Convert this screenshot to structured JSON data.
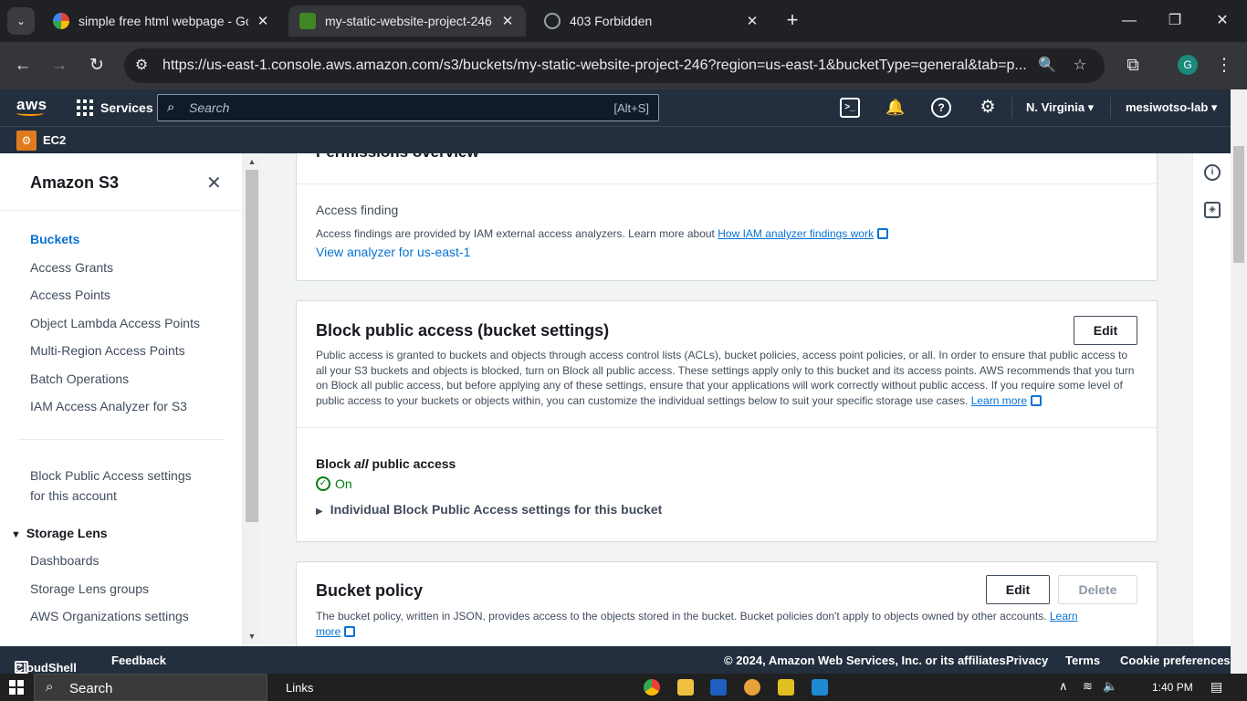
{
  "browser": {
    "tabs": [
      {
        "title": "simple free html webpage - Go",
        "favicon": "google-icon"
      },
      {
        "title": "my-static-website-project-246 -",
        "favicon": "s3-bucket-icon"
      },
      {
        "title": "403 Forbidden",
        "favicon": "globe-icon"
      }
    ],
    "url": "https://us-east-1.console.aws.amazon.com/s3/buckets/my-static-website-project-246?region=us-east-1&bucketType=general&tab=p...",
    "profile_initial": "G"
  },
  "aws_nav": {
    "logo": "aws",
    "services_label": "Services",
    "search_placeholder": "Search",
    "search_hint": "[Alt+S]",
    "region": "N. Virginia",
    "account": "mesiwotso-lab",
    "favorite": "EC2"
  },
  "sidebar": {
    "title": "Amazon S3",
    "items": [
      "Buckets",
      "Access Grants",
      "Access Points",
      "Object Lambda Access Points",
      "Multi-Region Access Points",
      "Batch Operations",
      "IAM Access Analyzer for S3"
    ],
    "block_public_line1": "Block Public Access settings",
    "block_public_line2": "for this account",
    "storage_lens": "Storage Lens",
    "storage_items": [
      "Dashboards",
      "Storage Lens groups",
      "AWS Organizations settings"
    ]
  },
  "main": {
    "permissions_heading": "Permissions overview",
    "access_finding_label": "Access finding",
    "access_finding_text": "Access findings are provided by IAM external access analyzers. Learn more about",
    "access_finding_link": "How IAM analyzer findings work",
    "view_analyzer": "View analyzer for us-east-1",
    "block_heading": "Block public access (bucket settings)",
    "block_edit": "Edit",
    "block_description": "Public access is granted to buckets and objects through access control lists (ACLs), bucket policies, access point policies, or all. In order to ensure that public access to all your S3 buckets and objects is blocked, turn on Block all public access. These settings apply only to this bucket and its access points. AWS recommends that you turn on Block all public access, but before applying any of these settings, ensure that your applications will work correctly without public access. If you require some level of public access to your buckets or objects within, you can customize the individual settings below to suit your specific storage use cases.",
    "learn_more": "Learn more",
    "block_all_pre": "Block ",
    "block_all_em": "all",
    "block_all_post": " public access",
    "status": "On",
    "individual_settings": "Individual Block Public Access settings for this bucket",
    "policy_heading": "Bucket policy",
    "policy_edit": "Edit",
    "policy_delete": "Delete",
    "policy_text": "The bucket policy, written in JSON, provides access to the objects stored in the bucket. Bucket policies don't apply to objects owned by other accounts.",
    "policy_learn": "Learn",
    "policy_more": "more"
  },
  "footer": {
    "cloudshell": "CloudShell",
    "feedback": "Feedback",
    "copyright": "© 2024, Amazon Web Services, Inc. or its affiliates.",
    "privacy": "Privacy",
    "terms": "Terms",
    "cookie": "Cookie preferences"
  },
  "taskbar": {
    "search": "Search",
    "links": "Links",
    "time": "1:40 PM"
  },
  "colors": {
    "aws_header": "#232f3e",
    "aws_orange": "#ff9900",
    "link_blue": "#0972d3",
    "success_green": "#037f0c"
  }
}
